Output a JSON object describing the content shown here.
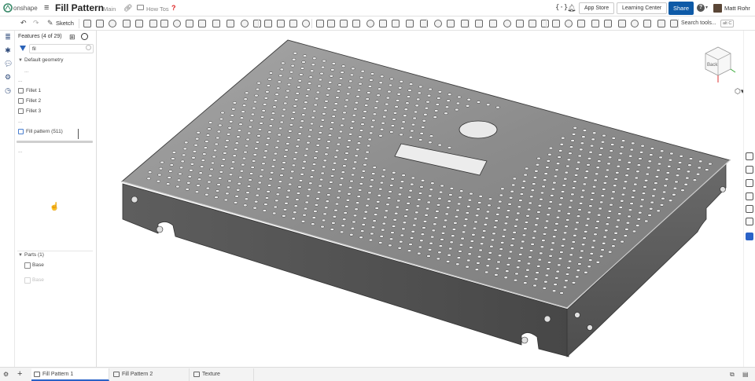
{
  "header": {
    "brand": "onshape",
    "document_title": "Fill Pattern",
    "workspace": "Main",
    "folder": "How Tos",
    "app_store": "App Store",
    "learning_center": "Learning Center",
    "share": "Share",
    "user_name": "Matt Rohr",
    "help_glyph": "?",
    "caret_glyph": "▾"
  },
  "toolbar": {
    "sketch_label": "Sketch",
    "search_placeholder": "Search tools...",
    "search_shortcut": "alt C"
  },
  "feature_tree": {
    "header": "Features (4 of 29)",
    "filter_value": "fil",
    "default_geometry": "Default geometry",
    "ellipsis": "...",
    "items": [
      {
        "label": "Fillet 1"
      },
      {
        "label": "Fillet 2"
      },
      {
        "label": "Fillet 3"
      }
    ],
    "fill_pattern": "Fill pattern (511)",
    "parts_header": "Parts (1)",
    "parts": [
      {
        "label": "Base"
      },
      {
        "label": "Base"
      }
    ]
  },
  "view_cube": {
    "front_label": "Back"
  },
  "tabs": [
    {
      "label": "Fill Pattern 1",
      "active": true
    },
    {
      "label": "Fill Pattern 2",
      "active": false
    },
    {
      "label": "Texture",
      "active": false
    }
  ],
  "colors": {
    "accent": "#0e5aa7",
    "active_tab_underline": "#2a62c7",
    "part_top": "#8a8a8a",
    "part_side": "#555555",
    "hole": "#e6e6e6"
  }
}
